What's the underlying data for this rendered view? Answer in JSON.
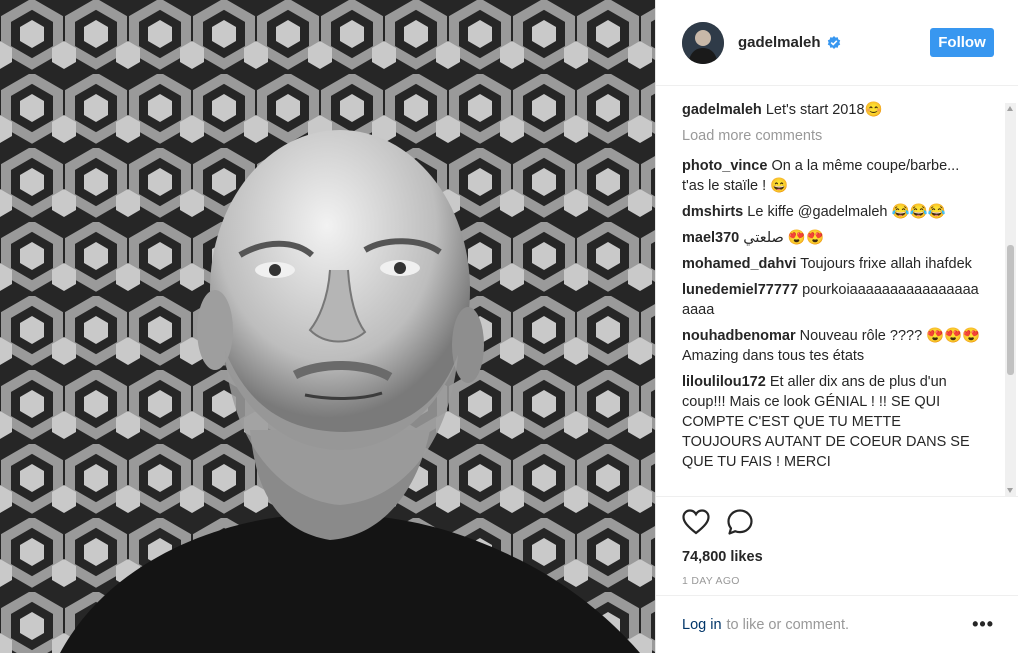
{
  "post": {
    "username": "gadelmaleh",
    "follow_label": "Follow",
    "caption_text": "Let's start 2018😊",
    "load_more": "Load more comments",
    "comments": [
      {
        "user": "photo_vince",
        "text": "On a la même coupe/barbe... t'as le staïle ! 😄"
      },
      {
        "user": "dmshirts",
        "text": "Le kiffe @gadelmaleh 😂😂😂"
      },
      {
        "user": "mael370",
        "text": "صلعتي 😍😍"
      },
      {
        "user": "mohamed_dahvi",
        "text": "Toujours frixe allah ihafdek"
      },
      {
        "user": "lunedemiel77777",
        "text": "pourkoiaaaaaaaaaaaaaaaaaaaa"
      },
      {
        "user": "nouhadbenomar",
        "text": "Nouveau rôle ???? 😍😍😍 Amazing dans tous tes états"
      },
      {
        "user": "liloulilou172",
        "text": "Et aller dix ans de plus d'un coup!!! Mais ce look GÉNIAL ! !! SE QUI COMPTE C'EST QUE TU METTE TOUJOURS AUTANT DE COEUR DANS SE QUE TU FAIS ! MERCI"
      }
    ],
    "likes": "74,800 likes",
    "time_ago": "1 DAY AGO",
    "login_link": "Log in",
    "login_text": "to like or comment.",
    "more_options": "•••"
  },
  "colors": {
    "accent": "#3897f0",
    "verified": "#3897f0",
    "muted": "#999999"
  },
  "icons": [
    "verified-badge-icon",
    "heart-icon",
    "comment-icon",
    "more-options-icon"
  ]
}
